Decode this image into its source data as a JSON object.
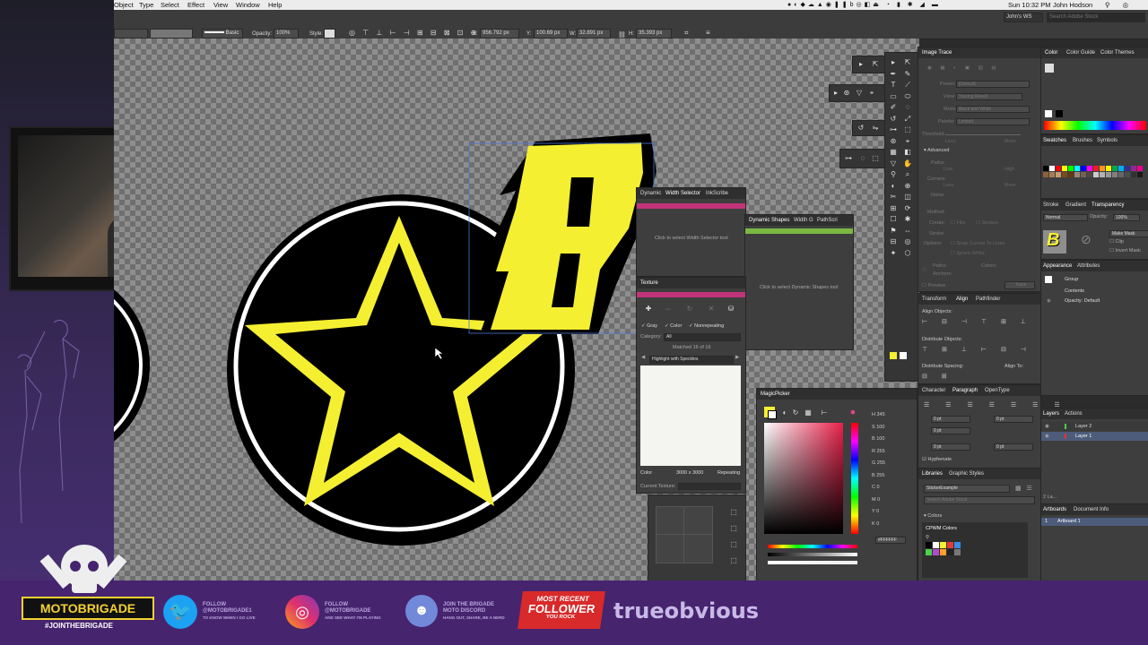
{
  "menubar": {
    "items": [
      "Object",
      "Type",
      "Select",
      "Effect",
      "View",
      "Window",
      "Help"
    ],
    "clock": "Sun 10:32 PM",
    "user": "John Hodson"
  },
  "controlbar": {
    "stroke_style": "Basic",
    "opacity_label": "Opacity:",
    "opacity_value": "100%",
    "style_label": "Style:",
    "x_label": "X:",
    "x_value": "956.792 px",
    "y_label": "Y:",
    "y_value": "100.69 px",
    "w_label": "W:",
    "w_value": "32.891 px",
    "h_label": "H:",
    "h_value": "35.393 px",
    "workspace": "John's WS",
    "search_placeholder": "Search Adobe Stock"
  },
  "canvas": {
    "sticker_letter": "B"
  },
  "width_panel": {
    "tabs": [
      "Dynamic",
      "Width Selector",
      "InkScribe"
    ],
    "message": "Click to select Width Selector tool"
  },
  "dynshapes_panel": {
    "tabs": [
      "Dynamic Shapes",
      "Width G",
      "PathScri"
    ],
    "message": "Click to select Dynamic Shapes tool"
  },
  "texture_panel": {
    "title": "Texture",
    "gray": "Gray",
    "color": "Color",
    "nonrepeating": "Nonrepeating",
    "category_label": "Category:",
    "category_value": "All",
    "matched": "Matched 16 of 16",
    "texture_name": "Highlight with Speckles",
    "color_label": "Color",
    "size": "3000 x 3000",
    "repeating": "Repeating",
    "current_label": "Current Texture:"
  },
  "magicpicker": {
    "title": "MagicPicker",
    "values": [
      "345",
      "100",
      "100",
      "255",
      "255",
      "255",
      "0",
      "0",
      "0",
      "0"
    ],
    "hex": "FFFFFF"
  },
  "image_trace": {
    "title": "Image Trace",
    "preset_label": "Preset:",
    "preset_value": "[Default]",
    "view_label": "View:",
    "view_value": "Tracing Result",
    "mode_label": "Mode:",
    "mode_value": "Black and White",
    "palette_label": "Palette:",
    "palette_value": "Limited",
    "threshold_label": "Threshold:",
    "less": "Less",
    "more": "More",
    "advanced": "Advanced",
    "paths": "Paths:",
    "corners": "Corners:",
    "noise": "Noise:",
    "low": "Low",
    "high": "High",
    "method": "Method:",
    "create": "Create:",
    "fills": "Fills",
    "strokes": "Strokes",
    "stroke": "Stroke:",
    "options": "Options:",
    "snap": "Snap Curves To Lines",
    "ignore": "Ignore White",
    "paths2": "Paths:",
    "colors2": "Colors:",
    "anchors": "Anchors:",
    "preview": "Preview",
    "trace": "Trace"
  },
  "color_panel": {
    "tabs": [
      "Color",
      "Color Guide",
      "Color Themes"
    ]
  },
  "swatches": {
    "tabs": [
      "Swatches",
      "Brushes",
      "Symbols"
    ],
    "colors": [
      "#000000",
      "#ffffff",
      "#ff0000",
      "#ffff00",
      "#00ff00",
      "#00ffff",
      "#0000ff",
      "#ff00ff",
      "#ed1c24",
      "#f7941d",
      "#fff200",
      "#00a651",
      "#00aeef",
      "#2e3192",
      "#92278f",
      "#ec008c",
      "#8c6239",
      "#a67c52",
      "#c69c6d",
      "#754c24",
      "#603913",
      "#998675",
      "#736357",
      "#534741",
      "#cccccc",
      "#b3b3b3",
      "#999999",
      "#808080",
      "#666666",
      "#4d4d4d",
      "#333333",
      "#1a1a1a"
    ]
  },
  "transparency": {
    "tabs": [
      "Stroke",
      "Gradient",
      "Transparency"
    ],
    "mode": "Normal",
    "opacity_label": "Opacity:",
    "opacity_value": "100%",
    "make_mask": "Make Mask",
    "clip": "Clip",
    "invert": "Invert Mask"
  },
  "appearance": {
    "tabs": [
      "Appearance",
      "Attributes"
    ],
    "group": "Group",
    "contents": "Contents",
    "opacity": "Opacity: Default"
  },
  "align": {
    "tabs": [
      "Transform",
      "Align",
      "Pathfinder"
    ],
    "align_objects": "Align Objects:",
    "distribute_objects": "Distribute Objects:",
    "distribute_spacing": "Distribute Spacing:",
    "align_to": "Align To:"
  },
  "paragraph": {
    "tabs": [
      "Character",
      "Paragraph",
      "OpenType"
    ],
    "pt": "0 pt",
    "hyphenate": "Hyphenate"
  },
  "libraries": {
    "tabs": [
      "Libraries",
      "Graphic Styles"
    ],
    "library": "StickerExample",
    "search_placeholder": "Search Adobe Stock",
    "colors": "Colors",
    "group": "CPWM Colors"
  },
  "layers": {
    "tabs": [
      "Layers",
      "Actions"
    ],
    "items": [
      "Layer 2",
      "Layer 1"
    ],
    "count": "2 La..."
  },
  "artboards": {
    "tabs": [
      "Artboards",
      "Document Info"
    ],
    "num": "1",
    "name": "Artboard 1"
  },
  "banner": {
    "brand": "MOTOBRIGADE",
    "hashtag": "#JOINTHEBRIGADE",
    "twitter_line1": "FOLLOW",
    "twitter_line2": "@MOTOBRIGADE1",
    "twitter_line3": "TO KNOW WHEN I GO LIVE",
    "insta_line1": "FOLLOW",
    "insta_line2": "@MOTOBRIGADE",
    "insta_line3": "AND SEE WHAT I'M PLAYING",
    "discord_line1": "JOIN THE BRIGADE",
    "discord_line2": "MOTO DISCORD",
    "discord_line3": "HANG OUT, SHARE, BE A NERD",
    "follower_line1": "MOST RECENT",
    "follower_line2": "FOLLOWER",
    "follower_line3": "YOU ROCK",
    "follower_name": "trueobvious"
  }
}
